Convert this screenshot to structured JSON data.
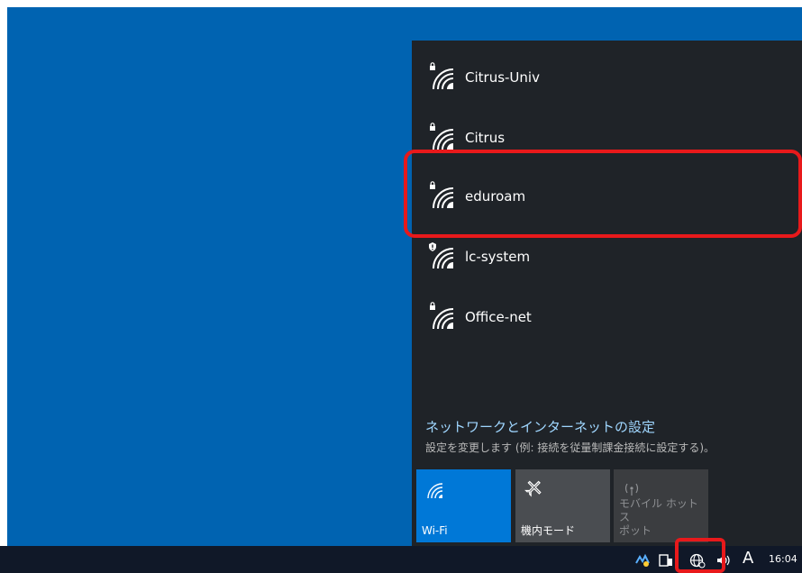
{
  "networks": [
    {
      "ssid": "Citrus-Univ",
      "icon": "wifi-secured-icon"
    },
    {
      "ssid": "Citrus",
      "icon": "wifi-secured-icon"
    },
    {
      "ssid": "eduroam",
      "icon": "wifi-secured-icon"
    },
    {
      "ssid": "lc-system",
      "icon": "wifi-warning-icon"
    },
    {
      "ssid": "Office-net",
      "icon": "wifi-secured-icon"
    }
  ],
  "settings": {
    "title": "ネットワークとインターネットの設定",
    "description": "設定を変更します (例: 接続を従量制課金接続に設定する)。"
  },
  "quick_actions": {
    "wifi": {
      "label": "Wi-Fi",
      "state": "on",
      "color": "#0078d7"
    },
    "airplane": {
      "label": "機内モード",
      "state": "off"
    },
    "hotspot": {
      "label_line1": "モバイル ホットス",
      "label_line2": "ポット",
      "state": "disabled"
    }
  },
  "taskbar": {
    "ime": "A",
    "time": "16:04"
  },
  "colors": {
    "desktop": "#0063b1",
    "flyout": "#1f2328",
    "accent": "#0078d7",
    "highlight": "#e8191b",
    "link": "#9fd6ff"
  }
}
